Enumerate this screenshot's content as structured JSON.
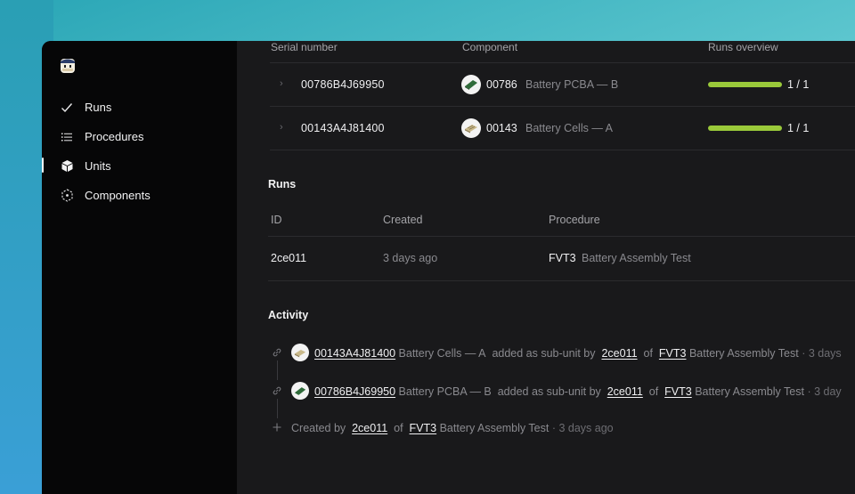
{
  "sidebar": {
    "items": [
      {
        "label": "Runs",
        "icon": "check-icon"
      },
      {
        "label": "Procedures",
        "icon": "list-icon"
      },
      {
        "label": "Units",
        "icon": "cube-icon"
      },
      {
        "label": "Components",
        "icon": "components-icon"
      }
    ],
    "active": "Units"
  },
  "units": {
    "headers": {
      "serial": "Serial number",
      "component": "Component",
      "runs": "Runs overview"
    },
    "rows": [
      {
        "serial": "00786B4J69950",
        "component_number": "00786",
        "component_name": "Battery PCBA — B",
        "runs": "1 / 1",
        "progress": 1.0
      },
      {
        "serial": "00143A4J81400",
        "component_number": "00143",
        "component_name": "Battery Cells — A",
        "runs": "1 / 1",
        "progress": 1.0
      }
    ]
  },
  "runs": {
    "title": "Runs",
    "headers": {
      "id": "ID",
      "created": "Created",
      "procedure": "Procedure"
    },
    "rows": [
      {
        "id": "2ce011",
        "created": "3 days ago",
        "procedure_code": "FVT3",
        "procedure_name": "Battery Assembly Test"
      }
    ]
  },
  "activity": {
    "title": "Activity",
    "items": [
      {
        "serial": "00143A4J81400",
        "component": "Battery Cells — A",
        "action": "added as sub-unit by",
        "run": "2ce011",
        "of": "of",
        "proc_code": "FVT3",
        "proc_name": "Battery Assembly Test",
        "time": "· 3 days"
      },
      {
        "serial": "00786B4J69950",
        "component": "Battery PCBA — B",
        "action": "added as sub-unit by",
        "run": "2ce011",
        "of": "of",
        "proc_code": "FVT3",
        "proc_name": "Battery Assembly Test",
        "time": "· 3 day"
      },
      {
        "prefix": "Created by",
        "run": "2ce011",
        "of": "of",
        "proc_code": "FVT3",
        "proc_name": "Battery Assembly Test",
        "time": "· 3 days ago"
      }
    ]
  },
  "colors": {
    "progress": "#9ac93a",
    "sidebar_bg": "#060607",
    "main_bg": "#19191b"
  }
}
